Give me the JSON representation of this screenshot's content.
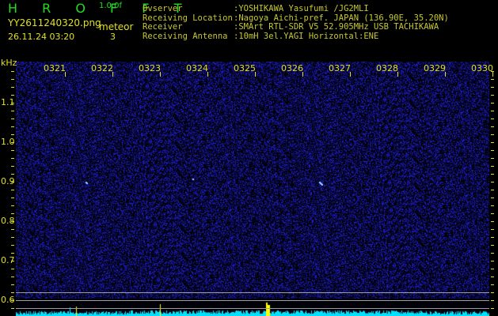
{
  "header": {
    "app_name": "H R O F F T",
    "version": "1.0.0f",
    "filename": "YY2611240320.png",
    "datetime": "26.11.24 03:20",
    "meteor_label": "meteor",
    "meteor_count": "3",
    "info": [
      {
        "label": "Ovserver",
        "value": ":YOSHIKAWA Yasufumi /JG2MLI"
      },
      {
        "label": "Receiving Location",
        "value": ":Nagoya Aichi-pref. JAPAN (136.90E, 35.20N)"
      },
      {
        "label": "Receiver",
        "value": ":SMArt RTL-SDR V5 52.905MHz USB TACHIKAWA"
      },
      {
        "label": "Receiving Antenna",
        "value": ":10mH 3el.YAGI Horizontal:ENE"
      }
    ]
  },
  "spectrogram": {
    "y_unit": "kHz",
    "y_ticks": [
      "1.1",
      "1.0",
      "0.9",
      "0.8",
      "0.7",
      "0.6"
    ],
    "time_ticks": [
      "0321",
      "0322",
      "0323",
      "0324",
      "0325",
      "0326",
      "0327",
      "0328",
      "0329",
      "0330"
    ],
    "colors": {
      "background": "#000010",
      "noise": "#2a2ad0",
      "histogram": "#00e0ff",
      "peak": "#ffff00",
      "text": "#e0e020"
    }
  }
}
